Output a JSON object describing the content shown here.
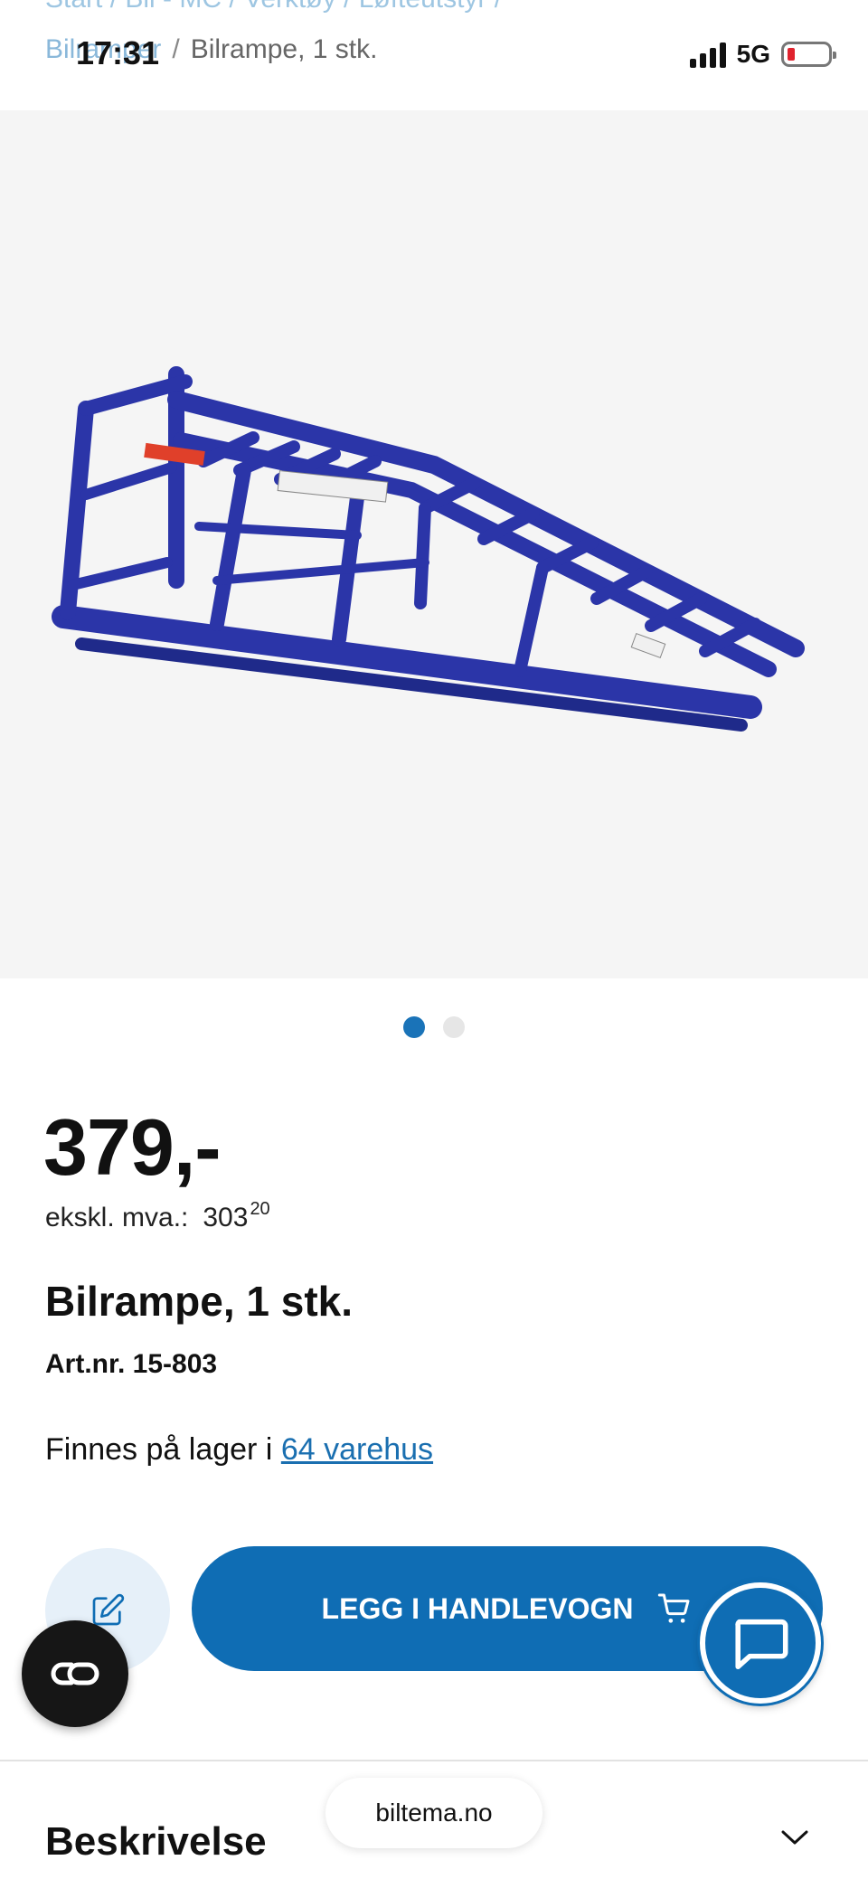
{
  "status_bar": {
    "time": "17:31",
    "network": "5G"
  },
  "breadcrumb": {
    "ghost_text": "Start /   Bil - MC /   Verktøy /   Løfteutstyr /",
    "link": "Bilramper",
    "separator": "/",
    "current": "Bilrampe, 1 stk."
  },
  "gallery": {
    "image_alt": "Bilrampe, 1 stk.",
    "slides": 2,
    "active_slide": 1
  },
  "product": {
    "price": "379,-",
    "excl_vat_label": "ekskl. mva.:",
    "excl_vat_main": "303",
    "excl_vat_decimals": "20",
    "title": "Bilrampe, 1 stk.",
    "article_number": "Art.nr. 15-803",
    "stock_prefix": "Finnes på lager i",
    "stock_link": "64 varehus"
  },
  "actions": {
    "add_to_cart": "LEGG I HANDLEVOGN",
    "note_icon": "edit-note-icon",
    "chat_icon": "chat-bubble-icon",
    "co_icon": "co-logo-icon"
  },
  "browser": {
    "url": "biltema.no"
  },
  "description": {
    "heading": "Beskrivelse"
  },
  "colors": {
    "brand_blue": "#0f6db4",
    "ramp_blue": "#2b35a8",
    "link_blue": "#1a6fb0"
  }
}
